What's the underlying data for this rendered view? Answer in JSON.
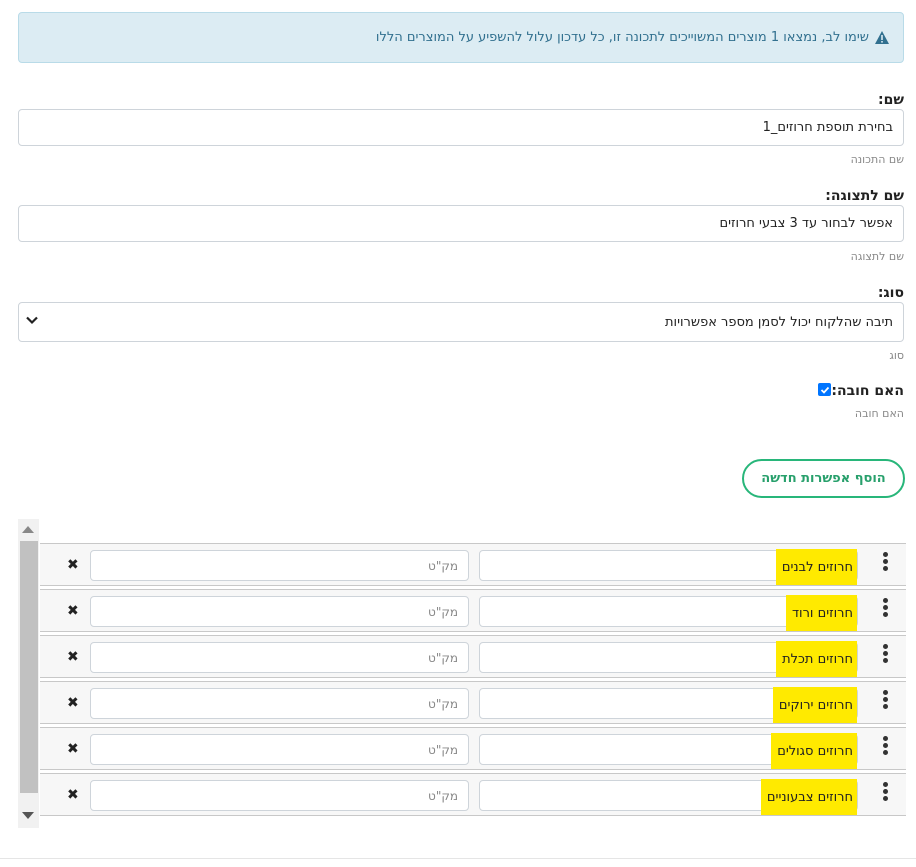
{
  "alert": {
    "text": "שימו לב, נמצאו 1 מוצרים המשוייכים לתכונה זו, כל עדכון עלול להשפיע על המוצרים הללו"
  },
  "name": {
    "label": "שם:",
    "value": "בחירת תוספת חרוזים_1",
    "help": "שם התכונה"
  },
  "display_name": {
    "label": "שם לתצוגה:",
    "value": "אפשר לבחור עד 3 צבעי חרוזים",
    "help": "שם לתצוגה"
  },
  "type": {
    "label": "סוג:",
    "value": "תיבה שהלקוח יכול לסמן מספר אפשרויות",
    "help": "סוג"
  },
  "required": {
    "label": "האם חובה:",
    "help": "האם חובה",
    "checked": true
  },
  "add_option_label": "הוסף אפשרות חדשה",
  "options": [
    {
      "name": "חרוזים לבנים",
      "sku_placeholder": "מק\"ט"
    },
    {
      "name": "חרוזים ורוד",
      "sku_placeholder": "מק\"ט"
    },
    {
      "name": "חרוזים תכלת",
      "sku_placeholder": "מק\"ט"
    },
    {
      "name": "חרוזים ירוקים",
      "sku_placeholder": "מק\"ט"
    },
    {
      "name": "חרוזים סגולים",
      "sku_placeholder": "מק\"ט"
    },
    {
      "name": "חרוזים צבעוניים",
      "sku_placeholder": "מק\"ט"
    }
  ],
  "colors": {
    "highlight": "#ffea00",
    "accent_green": "#28b67a",
    "alert_bg": "#dcecf3"
  },
  "icons": {
    "alert": "warning-icon",
    "select": "chevron-down-icon",
    "drag": "drag-handle-icon",
    "delete": "close-icon"
  }
}
